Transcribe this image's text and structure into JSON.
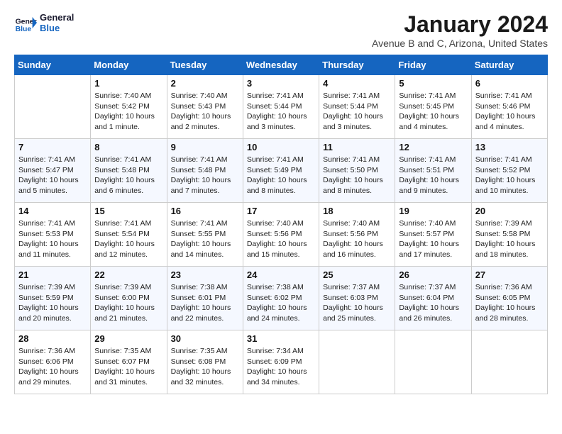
{
  "header": {
    "logo_line1": "General",
    "logo_line2": "Blue",
    "month_title": "January 2024",
    "location": "Avenue B and C, Arizona, United States"
  },
  "days_of_week": [
    "Sunday",
    "Monday",
    "Tuesday",
    "Wednesday",
    "Thursday",
    "Friday",
    "Saturday"
  ],
  "weeks": [
    [
      {
        "day": "",
        "info": ""
      },
      {
        "day": "1",
        "info": "Sunrise: 7:40 AM\nSunset: 5:42 PM\nDaylight: 10 hours\nand 1 minute."
      },
      {
        "day": "2",
        "info": "Sunrise: 7:40 AM\nSunset: 5:43 PM\nDaylight: 10 hours\nand 2 minutes."
      },
      {
        "day": "3",
        "info": "Sunrise: 7:41 AM\nSunset: 5:44 PM\nDaylight: 10 hours\nand 3 minutes."
      },
      {
        "day": "4",
        "info": "Sunrise: 7:41 AM\nSunset: 5:44 PM\nDaylight: 10 hours\nand 3 minutes."
      },
      {
        "day": "5",
        "info": "Sunrise: 7:41 AM\nSunset: 5:45 PM\nDaylight: 10 hours\nand 4 minutes."
      },
      {
        "day": "6",
        "info": "Sunrise: 7:41 AM\nSunset: 5:46 PM\nDaylight: 10 hours\nand 4 minutes."
      }
    ],
    [
      {
        "day": "7",
        "info": "Sunrise: 7:41 AM\nSunset: 5:47 PM\nDaylight: 10 hours\nand 5 minutes."
      },
      {
        "day": "8",
        "info": "Sunrise: 7:41 AM\nSunset: 5:48 PM\nDaylight: 10 hours\nand 6 minutes."
      },
      {
        "day": "9",
        "info": "Sunrise: 7:41 AM\nSunset: 5:48 PM\nDaylight: 10 hours\nand 7 minutes."
      },
      {
        "day": "10",
        "info": "Sunrise: 7:41 AM\nSunset: 5:49 PM\nDaylight: 10 hours\nand 8 minutes."
      },
      {
        "day": "11",
        "info": "Sunrise: 7:41 AM\nSunset: 5:50 PM\nDaylight: 10 hours\nand 8 minutes."
      },
      {
        "day": "12",
        "info": "Sunrise: 7:41 AM\nSunset: 5:51 PM\nDaylight: 10 hours\nand 9 minutes."
      },
      {
        "day": "13",
        "info": "Sunrise: 7:41 AM\nSunset: 5:52 PM\nDaylight: 10 hours\nand 10 minutes."
      }
    ],
    [
      {
        "day": "14",
        "info": "Sunrise: 7:41 AM\nSunset: 5:53 PM\nDaylight: 10 hours\nand 11 minutes."
      },
      {
        "day": "15",
        "info": "Sunrise: 7:41 AM\nSunset: 5:54 PM\nDaylight: 10 hours\nand 12 minutes."
      },
      {
        "day": "16",
        "info": "Sunrise: 7:41 AM\nSunset: 5:55 PM\nDaylight: 10 hours\nand 14 minutes."
      },
      {
        "day": "17",
        "info": "Sunrise: 7:40 AM\nSunset: 5:56 PM\nDaylight: 10 hours\nand 15 minutes."
      },
      {
        "day": "18",
        "info": "Sunrise: 7:40 AM\nSunset: 5:56 PM\nDaylight: 10 hours\nand 16 minutes."
      },
      {
        "day": "19",
        "info": "Sunrise: 7:40 AM\nSunset: 5:57 PM\nDaylight: 10 hours\nand 17 minutes."
      },
      {
        "day": "20",
        "info": "Sunrise: 7:39 AM\nSunset: 5:58 PM\nDaylight: 10 hours\nand 18 minutes."
      }
    ],
    [
      {
        "day": "21",
        "info": "Sunrise: 7:39 AM\nSunset: 5:59 PM\nDaylight: 10 hours\nand 20 minutes."
      },
      {
        "day": "22",
        "info": "Sunrise: 7:39 AM\nSunset: 6:00 PM\nDaylight: 10 hours\nand 21 minutes."
      },
      {
        "day": "23",
        "info": "Sunrise: 7:38 AM\nSunset: 6:01 PM\nDaylight: 10 hours\nand 22 minutes."
      },
      {
        "day": "24",
        "info": "Sunrise: 7:38 AM\nSunset: 6:02 PM\nDaylight: 10 hours\nand 24 minutes."
      },
      {
        "day": "25",
        "info": "Sunrise: 7:37 AM\nSunset: 6:03 PM\nDaylight: 10 hours\nand 25 minutes."
      },
      {
        "day": "26",
        "info": "Sunrise: 7:37 AM\nSunset: 6:04 PM\nDaylight: 10 hours\nand 26 minutes."
      },
      {
        "day": "27",
        "info": "Sunrise: 7:36 AM\nSunset: 6:05 PM\nDaylight: 10 hours\nand 28 minutes."
      }
    ],
    [
      {
        "day": "28",
        "info": "Sunrise: 7:36 AM\nSunset: 6:06 PM\nDaylight: 10 hours\nand 29 minutes."
      },
      {
        "day": "29",
        "info": "Sunrise: 7:35 AM\nSunset: 6:07 PM\nDaylight: 10 hours\nand 31 minutes."
      },
      {
        "day": "30",
        "info": "Sunrise: 7:35 AM\nSunset: 6:08 PM\nDaylight: 10 hours\nand 32 minutes."
      },
      {
        "day": "31",
        "info": "Sunrise: 7:34 AM\nSunset: 6:09 PM\nDaylight: 10 hours\nand 34 minutes."
      },
      {
        "day": "",
        "info": ""
      },
      {
        "day": "",
        "info": ""
      },
      {
        "day": "",
        "info": ""
      }
    ]
  ]
}
